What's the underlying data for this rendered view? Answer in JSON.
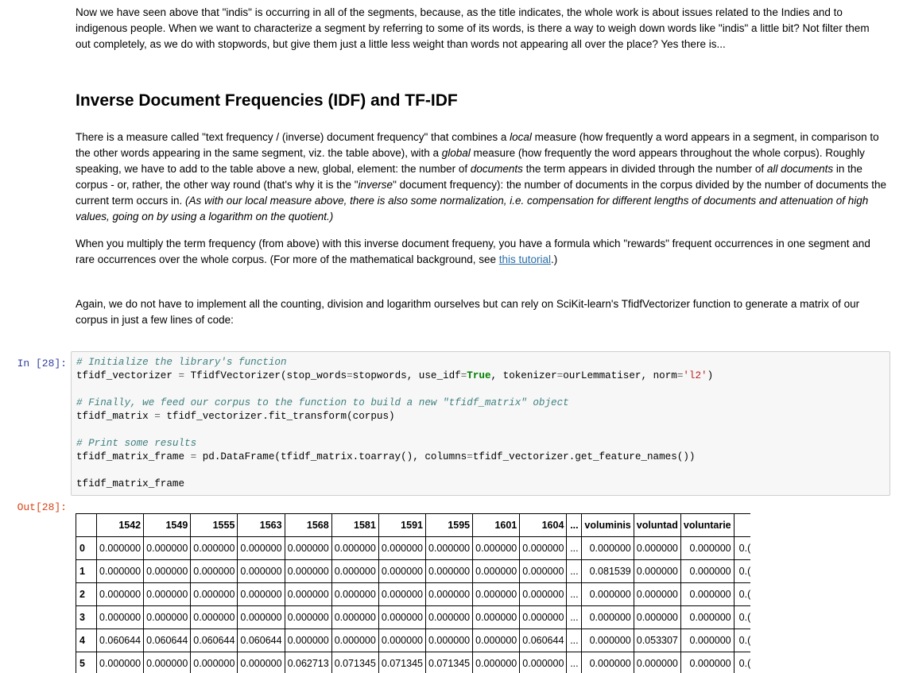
{
  "intro_paragraph": "Now we have seen above that \"indis\" is occurring in all of the segments, because, as the title indicates, the whole work is about issues related to the Indies and to indigenous people. When we want to characterize a segment by referring to some of its words, is there a way to weigh down words like \"indis\" a little bit? Not filter them out completely, as we do with stopwords, but give them just a little less weight than words not appearing all over the place? Yes there is...",
  "heading": "Inverse Document Frequencies (IDF) and TF-IDF",
  "para2": {
    "t1": "There is a measure called \"text frequency / (inverse) document frequency\" that combines a ",
    "i1": "local",
    "t2": " measure (how frequently a word appears in a segment, in comparison to the other words appearing in the same segment, viz. the table above), with a ",
    "i2": "global",
    "t3": " measure (how frequently the word appears throughout the whole corpus). Roughly speaking, we have to add to the table above a new, global, element: the number of ",
    "i3": "documents",
    "t4": " the term appears in divided through the number of ",
    "i4": "all documents",
    "t5": " in the corpus - or, rather, the other way round (that's why it is the \"",
    "i5": "inverse",
    "t6": "\" document frequency): the number of documents in the corpus divided by the number of documents the current term occurs in. ",
    "i6": "(As with our local measure above, there is also some normalization, i.e. compensation for different lengths of documents and attenuation of high values, going on by using a logarithm on the quotient.)"
  },
  "para3": {
    "t1": "When you multiply the term frequency (from above) with this inverse document frequeny, you have a formula which \"rewards\" frequent occurrences in one segment and rare occurrences over the whole corpus. (For more of the mathematical background, see ",
    "link": "this tutorial",
    "t2": ".)"
  },
  "para4": "Again, we do not have to implement all the counting, division and logarithm ourselves but can rely on SciKit-learn's TfidfVectorizer function to generate a matrix of our corpus in just a few lines of code:",
  "cell": {
    "in_prompt": "In [28]:",
    "out_prompt": "Out[28]:",
    "comment1": "# Initialize the library's function",
    "line2_a": "tfidf_vectorizer ",
    "line2_b": "=",
    "line2_c": " TfidfVectorizer(stop_words",
    "line2_d": "=",
    "line2_e": "stopwords, use_idf",
    "line2_f": "=",
    "line2_kw": "True",
    "line2_g": ", tokenizer",
    "line2_h": "=",
    "line2_i": "ourLemmatiser, norm",
    "line2_j": "=",
    "line2_str": "'l2'",
    "line2_k": ")",
    "comment2": "# Finally, we feed our corpus to the function to build a new \"tfidf_matrix\" object",
    "line4_a": "tfidf_matrix ",
    "line4_b": "=",
    "line4_c": " tfidf_vectorizer.fit_transform(corpus)",
    "comment3": "# Print some results",
    "line6_a": "tfidf_matrix_frame ",
    "line6_b": "=",
    "line6_c": " pd.DataFrame(tfidf_matrix.toarray(), columns",
    "line6_d": "=",
    "line6_e": "tfidf_vectorizer.get_feature_names())",
    "line7": "tfidf_matrix_frame"
  },
  "table": {
    "columns": [
      "1542",
      "1549",
      "1555",
      "1563",
      "1568",
      "1581",
      "1591",
      "1595",
      "1601",
      "1604",
      "...",
      "voluminis",
      "voluntad",
      "voluntarie"
    ],
    "rows": [
      {
        "index": "0",
        "values": [
          "0.000000",
          "0.000000",
          "0.000000",
          "0.000000",
          "0.000000",
          "0.000000",
          "0.000000",
          "0.000000",
          "0.000000",
          "0.000000",
          "...",
          "0.000000",
          "0.000000",
          "0.000000"
        ],
        "cut": "0.("
      },
      {
        "index": "1",
        "values": [
          "0.000000",
          "0.000000",
          "0.000000",
          "0.000000",
          "0.000000",
          "0.000000",
          "0.000000",
          "0.000000",
          "0.000000",
          "0.000000",
          "...",
          "0.081539",
          "0.000000",
          "0.000000"
        ],
        "cut": "0.("
      },
      {
        "index": "2",
        "values": [
          "0.000000",
          "0.000000",
          "0.000000",
          "0.000000",
          "0.000000",
          "0.000000",
          "0.000000",
          "0.000000",
          "0.000000",
          "0.000000",
          "...",
          "0.000000",
          "0.000000",
          "0.000000"
        ],
        "cut": "0.("
      },
      {
        "index": "3",
        "values": [
          "0.000000",
          "0.000000",
          "0.000000",
          "0.000000",
          "0.000000",
          "0.000000",
          "0.000000",
          "0.000000",
          "0.000000",
          "0.000000",
          "...",
          "0.000000",
          "0.000000",
          "0.000000"
        ],
        "cut": "0.("
      },
      {
        "index": "4",
        "values": [
          "0.060644",
          "0.060644",
          "0.060644",
          "0.060644",
          "0.000000",
          "0.000000",
          "0.000000",
          "0.000000",
          "0.000000",
          "0.060644",
          "...",
          "0.000000",
          "0.053307",
          "0.000000"
        ],
        "cut": "0.("
      },
      {
        "index": "5",
        "values": [
          "0.000000",
          "0.000000",
          "0.000000",
          "0.000000",
          "0.062713",
          "0.071345",
          "0.071345",
          "0.071345",
          "0.000000",
          "0.000000",
          "...",
          "0.000000",
          "0.000000",
          "0.000000"
        ],
        "cut": "0.("
      }
    ]
  }
}
